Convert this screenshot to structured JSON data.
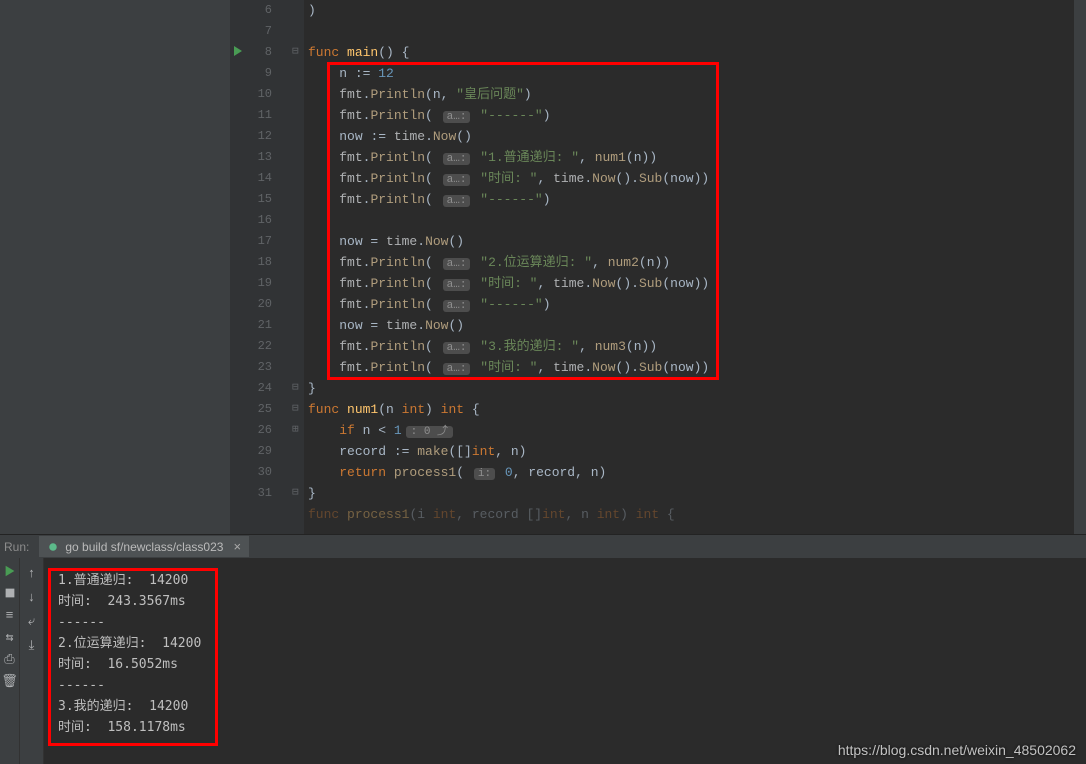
{
  "editor": {
    "lines": [
      {
        "n": 6,
        "indent": 0,
        "tokens": [
          {
            "t": ")",
            "c": "id"
          }
        ]
      },
      {
        "n": 7,
        "indent": 0,
        "tokens": []
      },
      {
        "n": 8,
        "indent": 0,
        "run": true,
        "fold": "⊟",
        "tokens": [
          {
            "t": "func ",
            "c": "kw"
          },
          {
            "t": "main",
            "c": "fn"
          },
          {
            "t": "() {",
            "c": "id"
          }
        ]
      },
      {
        "n": 9,
        "indent": 1,
        "tokens": [
          {
            "t": "n ",
            "c": "id"
          },
          {
            "t": ":= ",
            "c": "id"
          },
          {
            "t": "12",
            "c": "num"
          }
        ]
      },
      {
        "n": 10,
        "indent": 1,
        "tokens": [
          {
            "t": "fmt",
            "c": "pkg"
          },
          {
            "t": ".",
            "c": "id"
          },
          {
            "t": "Println",
            "c": "call"
          },
          {
            "t": "(n, ",
            "c": "id"
          },
          {
            "t": "\"皇后问题\"",
            "c": "str"
          },
          {
            "t": ")",
            "c": "id"
          }
        ]
      },
      {
        "n": 11,
        "indent": 1,
        "tokens": [
          {
            "t": "fmt",
            "c": "pkg"
          },
          {
            "t": ".",
            "c": "id"
          },
          {
            "t": "Println",
            "c": "call"
          },
          {
            "t": "( ",
            "c": "id"
          },
          {
            "hint": "a…:"
          },
          {
            "t": " ",
            "c": "id"
          },
          {
            "t": "\"------\"",
            "c": "str"
          },
          {
            "t": ")",
            "c": "id"
          }
        ]
      },
      {
        "n": 12,
        "indent": 1,
        "tokens": [
          {
            "t": "now ",
            "c": "id"
          },
          {
            "t": ":= ",
            "c": "id"
          },
          {
            "t": "time",
            "c": "pkg"
          },
          {
            "t": ".",
            "c": "id"
          },
          {
            "t": "Now",
            "c": "call"
          },
          {
            "t": "()",
            "c": "id"
          }
        ]
      },
      {
        "n": 13,
        "indent": 1,
        "tokens": [
          {
            "t": "fmt",
            "c": "pkg"
          },
          {
            "t": ".",
            "c": "id"
          },
          {
            "t": "Println",
            "c": "call"
          },
          {
            "t": "( ",
            "c": "id"
          },
          {
            "hint": "a…:"
          },
          {
            "t": " ",
            "c": "id"
          },
          {
            "t": "\"1.普通递归: \"",
            "c": "str"
          },
          {
            "t": ", ",
            "c": "id"
          },
          {
            "t": "num1",
            "c": "call"
          },
          {
            "t": "(n))",
            "c": "id"
          }
        ]
      },
      {
        "n": 14,
        "indent": 1,
        "tokens": [
          {
            "t": "fmt",
            "c": "pkg"
          },
          {
            "t": ".",
            "c": "id"
          },
          {
            "t": "Println",
            "c": "call"
          },
          {
            "t": "( ",
            "c": "id"
          },
          {
            "hint": "a…:"
          },
          {
            "t": " ",
            "c": "id"
          },
          {
            "t": "\"时间: \"",
            "c": "str"
          },
          {
            "t": ", ",
            "c": "id"
          },
          {
            "t": "time",
            "c": "pkg"
          },
          {
            "t": ".",
            "c": "id"
          },
          {
            "t": "Now",
            "c": "call"
          },
          {
            "t": "().",
            "c": "id"
          },
          {
            "t": "Sub",
            "c": "call"
          },
          {
            "t": "(now))",
            "c": "id"
          }
        ]
      },
      {
        "n": 15,
        "indent": 1,
        "tokens": [
          {
            "t": "fmt",
            "c": "pkg"
          },
          {
            "t": ".",
            "c": "id"
          },
          {
            "t": "Println",
            "c": "call"
          },
          {
            "t": "( ",
            "c": "id"
          },
          {
            "hint": "a…:"
          },
          {
            "t": " ",
            "c": "id"
          },
          {
            "t": "\"------\"",
            "c": "str"
          },
          {
            "t": ")",
            "c": "id"
          }
        ]
      },
      {
        "n": 16,
        "indent": 1,
        "tokens": []
      },
      {
        "n": 17,
        "indent": 1,
        "tokens": [
          {
            "t": "now = ",
            "c": "id"
          },
          {
            "t": "time",
            "c": "pkg"
          },
          {
            "t": ".",
            "c": "id"
          },
          {
            "t": "Now",
            "c": "call"
          },
          {
            "t": "()",
            "c": "id"
          }
        ]
      },
      {
        "n": 18,
        "indent": 1,
        "tokens": [
          {
            "t": "fmt",
            "c": "pkg"
          },
          {
            "t": ".",
            "c": "id"
          },
          {
            "t": "Println",
            "c": "call"
          },
          {
            "t": "( ",
            "c": "id"
          },
          {
            "hint": "a…:"
          },
          {
            "t": " ",
            "c": "id"
          },
          {
            "t": "\"2.位运算递归: \"",
            "c": "str"
          },
          {
            "t": ", ",
            "c": "id"
          },
          {
            "t": "num2",
            "c": "call"
          },
          {
            "t": "(n))",
            "c": "id"
          }
        ]
      },
      {
        "n": 19,
        "indent": 1,
        "tokens": [
          {
            "t": "fmt",
            "c": "pkg"
          },
          {
            "t": ".",
            "c": "id"
          },
          {
            "t": "Println",
            "c": "call"
          },
          {
            "t": "( ",
            "c": "id"
          },
          {
            "hint": "a…:"
          },
          {
            "t": " ",
            "c": "id"
          },
          {
            "t": "\"时间: \"",
            "c": "str"
          },
          {
            "t": ", ",
            "c": "id"
          },
          {
            "t": "time",
            "c": "pkg"
          },
          {
            "t": ".",
            "c": "id"
          },
          {
            "t": "Now",
            "c": "call"
          },
          {
            "t": "().",
            "c": "id"
          },
          {
            "t": "Sub",
            "c": "call"
          },
          {
            "t": "(now))",
            "c": "id"
          }
        ]
      },
      {
        "n": 20,
        "indent": 1,
        "tokens": [
          {
            "t": "fmt",
            "c": "pkg"
          },
          {
            "t": ".",
            "c": "id"
          },
          {
            "t": "Println",
            "c": "call"
          },
          {
            "t": "( ",
            "c": "id"
          },
          {
            "hint": "a…:"
          },
          {
            "t": " ",
            "c": "id"
          },
          {
            "t": "\"------\"",
            "c": "str"
          },
          {
            "t": ")",
            "c": "id"
          }
        ]
      },
      {
        "n": 21,
        "indent": 1,
        "tokens": [
          {
            "t": "now = ",
            "c": "id"
          },
          {
            "t": "time",
            "c": "pkg"
          },
          {
            "t": ".",
            "c": "id"
          },
          {
            "t": "Now",
            "c": "call"
          },
          {
            "t": "()",
            "c": "id"
          }
        ]
      },
      {
        "n": 22,
        "indent": 1,
        "tokens": [
          {
            "t": "fmt",
            "c": "pkg"
          },
          {
            "t": ".",
            "c": "id"
          },
          {
            "t": "Println",
            "c": "call"
          },
          {
            "t": "( ",
            "c": "id"
          },
          {
            "hint": "a…:"
          },
          {
            "t": " ",
            "c": "id"
          },
          {
            "t": "\"3.我的递归: \"",
            "c": "str"
          },
          {
            "t": ", ",
            "c": "id"
          },
          {
            "t": "num3",
            "c": "call"
          },
          {
            "t": "(n))",
            "c": "id"
          }
        ]
      },
      {
        "n": 23,
        "indent": 1,
        "tokens": [
          {
            "t": "fmt",
            "c": "pkg"
          },
          {
            "t": ".",
            "c": "id"
          },
          {
            "t": "Println",
            "c": "call"
          },
          {
            "t": "( ",
            "c": "id"
          },
          {
            "hint": "a…:"
          },
          {
            "t": " ",
            "c": "id"
          },
          {
            "t": "\"时间: \"",
            "c": "str"
          },
          {
            "t": ", ",
            "c": "id"
          },
          {
            "t": "time",
            "c": "pkg"
          },
          {
            "t": ".",
            "c": "id"
          },
          {
            "t": "Now",
            "c": "call"
          },
          {
            "t": "().",
            "c": "id"
          },
          {
            "t": "Sub",
            "c": "call"
          },
          {
            "t": "(now))",
            "c": "id"
          }
        ]
      },
      {
        "n": 24,
        "indent": 0,
        "fold": "⊟",
        "tokens": [
          {
            "t": "}",
            "c": "id"
          }
        ]
      },
      {
        "n": 25,
        "indent": 0,
        "fold": "⊟",
        "tokens": [
          {
            "t": "func ",
            "c": "kw"
          },
          {
            "t": "num1",
            "c": "fn"
          },
          {
            "t": "(n ",
            "c": "id"
          },
          {
            "t": "int",
            "c": "kw"
          },
          {
            "t": ") ",
            "c": "id"
          },
          {
            "t": "int",
            "c": "kw"
          },
          {
            "t": " {",
            "c": "id"
          }
        ]
      },
      {
        "n": 26,
        "indent": 1,
        "fold": "⊞",
        "tokens": [
          {
            "t": "if ",
            "c": "kw"
          },
          {
            "t": "n < ",
            "c": "id"
          },
          {
            "t": "1",
            "c": "num"
          },
          {
            "inlay": ": 0 ⤴"
          }
        ]
      },
      {
        "n": 29,
        "indent": 1,
        "tokens": [
          {
            "t": "record ",
            "c": "id"
          },
          {
            "t": ":= ",
            "c": "id"
          },
          {
            "t": "make",
            "c": "call"
          },
          {
            "t": "([]",
            "c": "id"
          },
          {
            "t": "int",
            "c": "kw"
          },
          {
            "t": ", n)",
            "c": "id"
          }
        ]
      },
      {
        "n": 30,
        "indent": 1,
        "tokens": [
          {
            "t": "return ",
            "c": "kw"
          },
          {
            "t": "process1",
            "c": "call"
          },
          {
            "t": "( ",
            "c": "id"
          },
          {
            "hint": "i:"
          },
          {
            "t": " ",
            "c": "id"
          },
          {
            "t": "0",
            "c": "num"
          },
          {
            "t": ", record, n)",
            "c": "id"
          }
        ]
      },
      {
        "n": 31,
        "indent": 0,
        "fold": "⊟",
        "tokens": [
          {
            "t": "}",
            "c": "id"
          }
        ]
      },
      {
        "n": "",
        "indent": 0,
        "tokens": [
          {
            "t": "func ",
            "c": "kw"
          },
          {
            "t": "process1",
            "c": "fn"
          },
          {
            "t": "(i ",
            "c": "id"
          },
          {
            "t": "int",
            "c": "kw"
          },
          {
            "t": ", record []",
            "c": "id"
          },
          {
            "t": "int",
            "c": "kw"
          },
          {
            "t": ", n ",
            "c": "id"
          },
          {
            "t": "int",
            "c": "kw"
          },
          {
            "t": ") ",
            "c": "id"
          },
          {
            "t": "int",
            "c": "kw"
          },
          {
            "t": " {",
            "c": "id"
          }
        ],
        "dim": true
      }
    ]
  },
  "breadcrumb": "process1(i int, record []int, n int) int",
  "run": {
    "label": "Run:",
    "tab": "go build sf/newclass/class023",
    "output": [
      "1.普通递归:  14200",
      "时间:  243.3567ms",
      "------",
      "2.位运算递归:  14200",
      "时间:  16.5052ms",
      "------",
      "3.我的递归:  14200",
      "时间:  158.1178ms"
    ]
  },
  "watermark": "https://blog.csdn.net/weixin_48502062"
}
